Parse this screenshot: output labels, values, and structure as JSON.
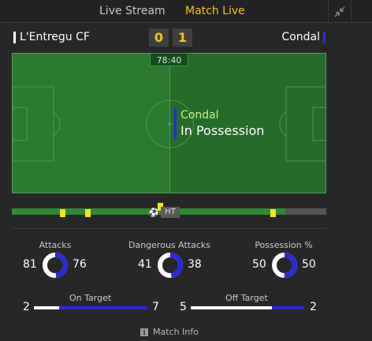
{
  "tabs": [
    {
      "label": "Live Stream"
    },
    {
      "label": "Match Live",
      "active": true
    }
  ],
  "icons": {
    "collapse": "collapse-arrows-icon",
    "info": "info-icon",
    "ball": "football-icon"
  },
  "match": {
    "home_team": "L'Entregu CF",
    "away_team": "Condal",
    "home_score": "0",
    "away_score": "1",
    "clock": "78:40",
    "home_color": "#ffffff",
    "away_color": "#2a2ae0"
  },
  "possession_banner": {
    "team": "Condal",
    "text": "In Possession"
  },
  "timeline": {
    "progress": 0.87,
    "ht_label": "HT",
    "yellow_cards": [
      0.16,
      0.24,
      0.47,
      0.83
    ]
  },
  "stats": {
    "attacks": {
      "label": "Attacks",
      "home": "81",
      "away": "76"
    },
    "dangerous_attacks": {
      "label": "Dangerous Attacks",
      "home": "41",
      "away": "38"
    },
    "possession": {
      "label": "Possession %",
      "home": "50",
      "away": "50"
    },
    "on_target": {
      "label": "On Target",
      "home": "2",
      "away": "7"
    },
    "off_target": {
      "label": "Off Target",
      "home": "5",
      "away": "2"
    }
  },
  "footer": {
    "match_info": "Match Info"
  },
  "colors": {
    "accent": "#f5c518",
    "pitch": "#2b7a2f",
    "away": "#2a2ae0"
  }
}
